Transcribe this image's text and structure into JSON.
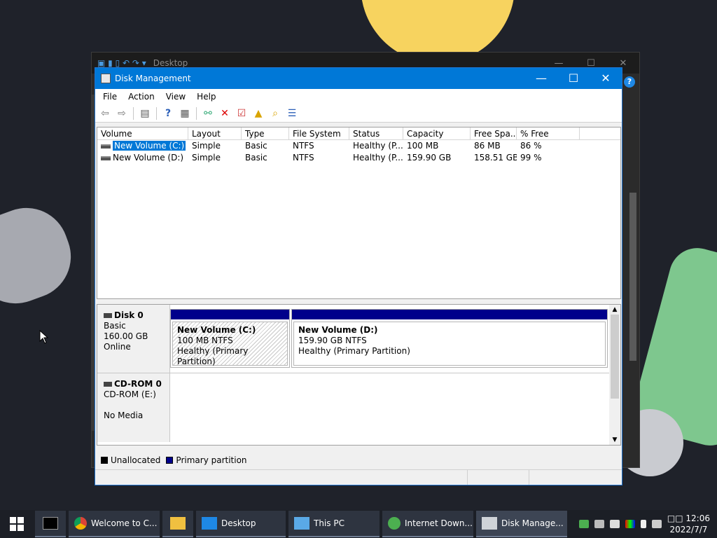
{
  "background_window": {
    "title": "Desktop",
    "controls": [
      "—",
      "☐",
      "✕"
    ],
    "help": "?"
  },
  "window": {
    "title": "Disk Management",
    "controls": [
      "—",
      "☐",
      "✕"
    ]
  },
  "menu": [
    "File",
    "Action",
    "View",
    "Help"
  ],
  "toolbar_icons": [
    "back-icon",
    "forward-icon",
    "console-tree-icon",
    "help-icon",
    "show-list-icon",
    "connect-icon",
    "delete-icon",
    "properties-icon",
    "folder-up-icon",
    "folder-search-icon",
    "settings-list-icon"
  ],
  "columns": [
    "Volume",
    "Layout",
    "Type",
    "File System",
    "Status",
    "Capacity",
    "Free Spa...",
    "% Free"
  ],
  "volumes": [
    {
      "name": "New Volume (C:)",
      "layout": "Simple",
      "type": "Basic",
      "fs": "NTFS",
      "status": "Healthy (P...",
      "capacity": "100 MB",
      "free": "86 MB",
      "pct": "86 %"
    },
    {
      "name": "New Volume (D:)",
      "layout": "Simple",
      "type": "Basic",
      "fs": "NTFS",
      "status": "Healthy (P...",
      "capacity": "159.90 GB",
      "free": "158.51 GB",
      "pct": "99 %"
    }
  ],
  "disks": [
    {
      "name": "Disk 0",
      "type": "Basic",
      "size": "160.00 GB",
      "state": "Online",
      "partitions": [
        {
          "name": "New Volume  (C:)",
          "size": "100 MB NTFS",
          "status": "Healthy (Primary Partition)"
        },
        {
          "name": "New Volume  (D:)",
          "size": "159.90 GB NTFS",
          "status": "Healthy (Primary Partition)"
        }
      ]
    },
    {
      "name": "CD-ROM 0",
      "type": "CD-ROM (E:)",
      "state": "No Media"
    }
  ],
  "legend": [
    {
      "label": "Unallocated",
      "color": "#000000"
    },
    {
      "label": "Primary partition",
      "color": "#00008b"
    }
  ],
  "taskbar": {
    "items": [
      {
        "label": "",
        "icon": "terminal-icon"
      },
      {
        "label": "Welcome to C...",
        "icon": "chrome-icon"
      },
      {
        "label": "",
        "icon": "file-explorer-icon"
      },
      {
        "label": "Desktop",
        "icon": "desktop-icon"
      },
      {
        "label": "This PC",
        "icon": "this-pc-icon"
      },
      {
        "label": "Internet Down...",
        "icon": "idm-icon"
      },
      {
        "label": "Disk Manage...",
        "icon": "disk-management-icon"
      }
    ],
    "clock_time": "12:06",
    "clock_date": "2022/7/7",
    "clock_prefix": "□□"
  },
  "colors": {
    "accent": "#0078d7",
    "primary_partition": "#00008b",
    "taskbar": "#1c1f26"
  }
}
